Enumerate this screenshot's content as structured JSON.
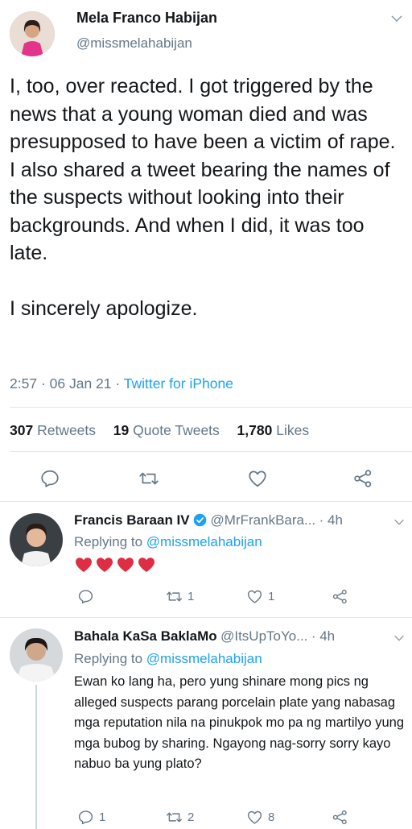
{
  "main_tweet": {
    "display_name": "Mela Franco Habijan",
    "handle": "@missmelahabijan",
    "text": "I, too, over reacted. I got triggered by the news that a young woman died and was presupposed to have been a victim of rape. I also shared a tweet bearing the names of the suspects without looking into their backgrounds. And when I did, it was too late.\n\nI sincerely apologize.",
    "time": "2:57",
    "date": "06 Jan 21",
    "source": "Twitter for iPhone",
    "stats": {
      "retweets_count": "307",
      "retweets_label": "Retweets",
      "quotes_count": "19",
      "quotes_label": "Quote Tweets",
      "likes_count": "1,780",
      "likes_label": "Likes"
    }
  },
  "replies": [
    {
      "display_name": "Francis Baraan IV",
      "handle": "@MrFrankBara...",
      "age": "· 4h",
      "replying_prefix": "Replying to",
      "replying_to": "@missmelahabijan",
      "text": "❤️❤️❤️❤️",
      "replies_count": "",
      "retweets_count": "1",
      "likes_count": "1"
    },
    {
      "display_name": "Bahala KaSa BaklaMo",
      "handle": "@ItsUpToYo...",
      "age": "· 4h",
      "replying_prefix": "Replying to",
      "replying_to": "@missmelahabijan",
      "text": "Ewan ko lang ha, pero yung shinare mong pics ng alleged suspects parang porcelain plate yang nabasag mga reputation nila na pinukpok mo pa ng martilyo yung mga bubog by sharing. Ngayong nag-sorry sorry kayo nabuo ba yung plato?",
      "replies_count": "1",
      "retweets_count": "2",
      "likes_count": "8"
    }
  ],
  "colors": {
    "accent": "#1da1f2",
    "heart": "#e0245e",
    "muted": "#657786"
  }
}
